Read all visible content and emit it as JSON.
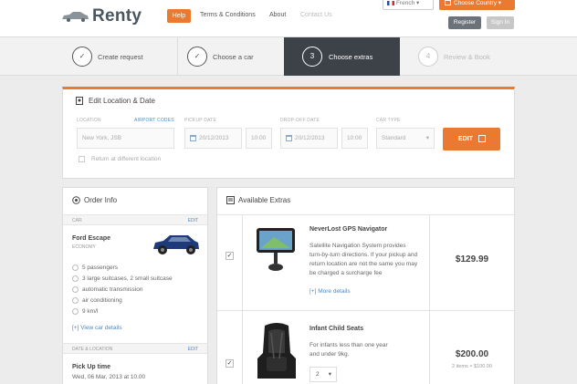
{
  "brand": {
    "name": "Renty"
  },
  "nav": {
    "help": "Help",
    "terms": "Terms & Conditions",
    "about": "About",
    "contacts": "Contact Us"
  },
  "header": {
    "language": "French",
    "country": "Choose Country",
    "register": "Register",
    "sign_in": "Sign In"
  },
  "steps": [
    {
      "number": "✓",
      "label": "Create request"
    },
    {
      "number": "✓",
      "label": "Choose a car"
    },
    {
      "number": "3",
      "label": "Choose extras"
    },
    {
      "number": "4",
      "label": "Review & Book"
    }
  ],
  "edit": {
    "title": "Edit Location & Date",
    "location_label": "LOCATION",
    "airport_codes": "AIRPORT CODES",
    "location_value": "New York, JSB",
    "pickup_label": "PICKUP DATE",
    "pickup_date": "20/12/2013",
    "pickup_time": "10:00",
    "dropoff_label": "DROP-OFF DATE",
    "dropoff_date": "20/12/2013",
    "dropoff_time": "10:00",
    "cartype_label": "CAR TYPE",
    "cartype_value": "Standard",
    "edit_button": "EDIT",
    "return_label": "Return at different location"
  },
  "order": {
    "title": "Order Info",
    "car_section": "CAR",
    "edit": "EDIT",
    "car_name": "Ford Escape",
    "car_class": "ECONOMY",
    "features": [
      "5 passengers",
      "3 large suitcases, 2 small suitcase",
      "automatic transmission",
      "air conditioning",
      "9 km/l"
    ],
    "view_details": "[+] View car details",
    "date_section": "DATE & LOCATION",
    "date_edit": "EDIT",
    "pickup_title": "Pick Up time",
    "pickup_value": "Wed, 06 Mar, 2013 at 10.00"
  },
  "extras": {
    "title": "Available Extras",
    "items": [
      {
        "name": "NeverLost GPS Navigator",
        "description": "Satellite Navigation System provides turn-by-turn directions. If your pickup and return location are not the same you may be charged a surcharge fee",
        "more": "[+] More details",
        "price": "$129.99",
        "checked": "✓"
      },
      {
        "name": "Infant Child Seats",
        "description": "For infants less than one year and under 9kg.",
        "quantity": "2",
        "price": "$200.00",
        "price_note": "2 items × $100.00",
        "checked": "✓"
      }
    ]
  },
  "colors": {
    "accent": "#ea7a31",
    "dark": "#3d4249",
    "link": "#4a8ac6"
  }
}
